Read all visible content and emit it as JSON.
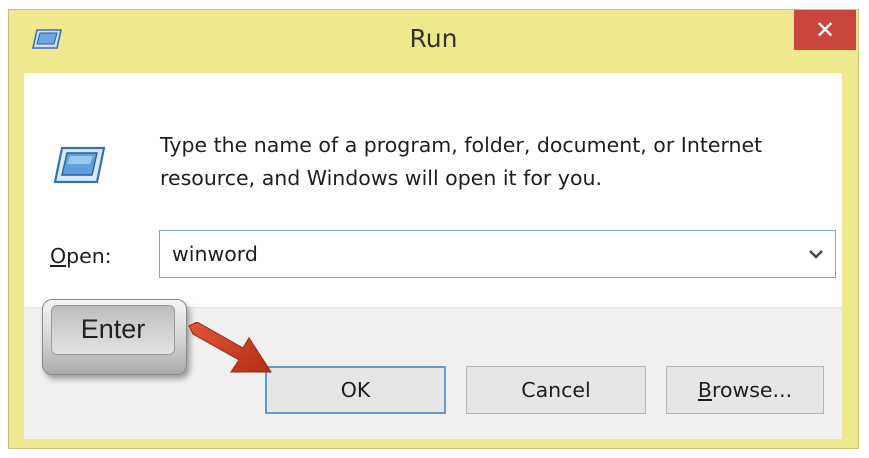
{
  "window": {
    "title": "Run",
    "close_symbol": "✕",
    "title_icon": "run-icon"
  },
  "content": {
    "icon": "run-icon",
    "description": "Type the name of a program, folder, document, or Internet resource, and Windows will open it for you."
  },
  "open": {
    "label_accel": "O",
    "label_rest": "pen:",
    "value": "winword",
    "dropdown_icon": "chevron-down-icon"
  },
  "buttons": {
    "ok": "OK",
    "cancel": "Cancel",
    "browse_accel": "B",
    "browse_rest": "rowse..."
  },
  "overlay": {
    "key_label": "Enter",
    "arrow_color": "#d9431f"
  },
  "colors": {
    "titlebar": "#eee98f",
    "close_button": "#c9463d",
    "focus_border": "#5f9bd6"
  }
}
